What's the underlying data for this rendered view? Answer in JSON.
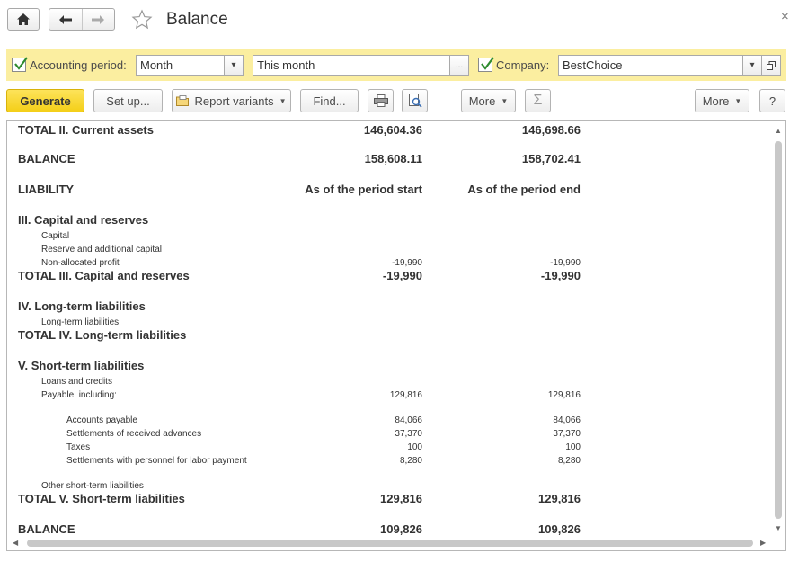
{
  "window": {
    "title": "Balance",
    "close": "×"
  },
  "filters": {
    "period_label": "Accounting period:",
    "period_type": "Month",
    "period_value": "This month",
    "period_button": "...",
    "company_label": "Company:",
    "company_value": "BestChoice"
  },
  "toolbar": {
    "generate": "Generate",
    "setup": "Set up...",
    "report_variants": "Report variants",
    "find": "Find...",
    "more1": "More",
    "sum": "Σ",
    "more2": "More",
    "help": "?"
  },
  "report": {
    "rows": [
      {
        "label": "TOTAL II. Current assets",
        "start": "146,604.36",
        "end": "146,698.66",
        "style": "bold"
      },
      {
        "label": "BALANCE",
        "start": "158,608.11",
        "end": "158,702.41",
        "style": "bold"
      },
      {
        "label": "LIABILITY",
        "start": "As of the period start",
        "end": "As of the period end",
        "style": "bold"
      },
      {
        "label": "III. Capital and reserves",
        "start": "",
        "end": "",
        "style": "bold"
      },
      {
        "label": "Capital",
        "start": "",
        "end": "",
        "style": "small1"
      },
      {
        "label": "Reserve and additional capital",
        "start": "",
        "end": "",
        "style": "small1"
      },
      {
        "label": "Non-allocated profit",
        "start": "-19,990",
        "end": "-19,990",
        "style": "small1"
      },
      {
        "label": "TOTAL III. Capital and reserves",
        "start": "-19,990",
        "end": "-19,990",
        "style": "bold"
      },
      {
        "label": "IV. Long-term liabilities",
        "start": "",
        "end": "",
        "style": "bold"
      },
      {
        "label": "Long-term liabilities",
        "start": "",
        "end": "",
        "style": "small1"
      },
      {
        "label": "TOTAL IV. Long-term liabilities",
        "start": "",
        "end": "",
        "style": "bold"
      },
      {
        "label": "V. Short-term liabilities",
        "start": "",
        "end": "",
        "style": "bold"
      },
      {
        "label": "Loans and credits",
        "start": "",
        "end": "",
        "style": "small1"
      },
      {
        "label": "Payable, including:",
        "start": "129,816",
        "end": "129,816",
        "style": "small1"
      },
      {
        "label": "Accounts payable",
        "start": "84,066",
        "end": "84,066",
        "style": "small2"
      },
      {
        "label": "Settlements of received advances",
        "start": "37,370",
        "end": "37,370",
        "style": "small2"
      },
      {
        "label": "Taxes",
        "start": "100",
        "end": "100",
        "style": "small2"
      },
      {
        "label": "Settlements with personnel for labor payment",
        "start": "8,280",
        "end": "8,280",
        "style": "small2"
      },
      {
        "label": "Other short-term liabilities",
        "start": "",
        "end": "",
        "style": "small1"
      },
      {
        "label": "TOTAL V. Short-term liabilities",
        "start": "129,816",
        "end": "129,816",
        "style": "bold"
      },
      {
        "label": "BALANCE",
        "start": "109,826",
        "end": "109,826",
        "style": "bold"
      }
    ]
  }
}
